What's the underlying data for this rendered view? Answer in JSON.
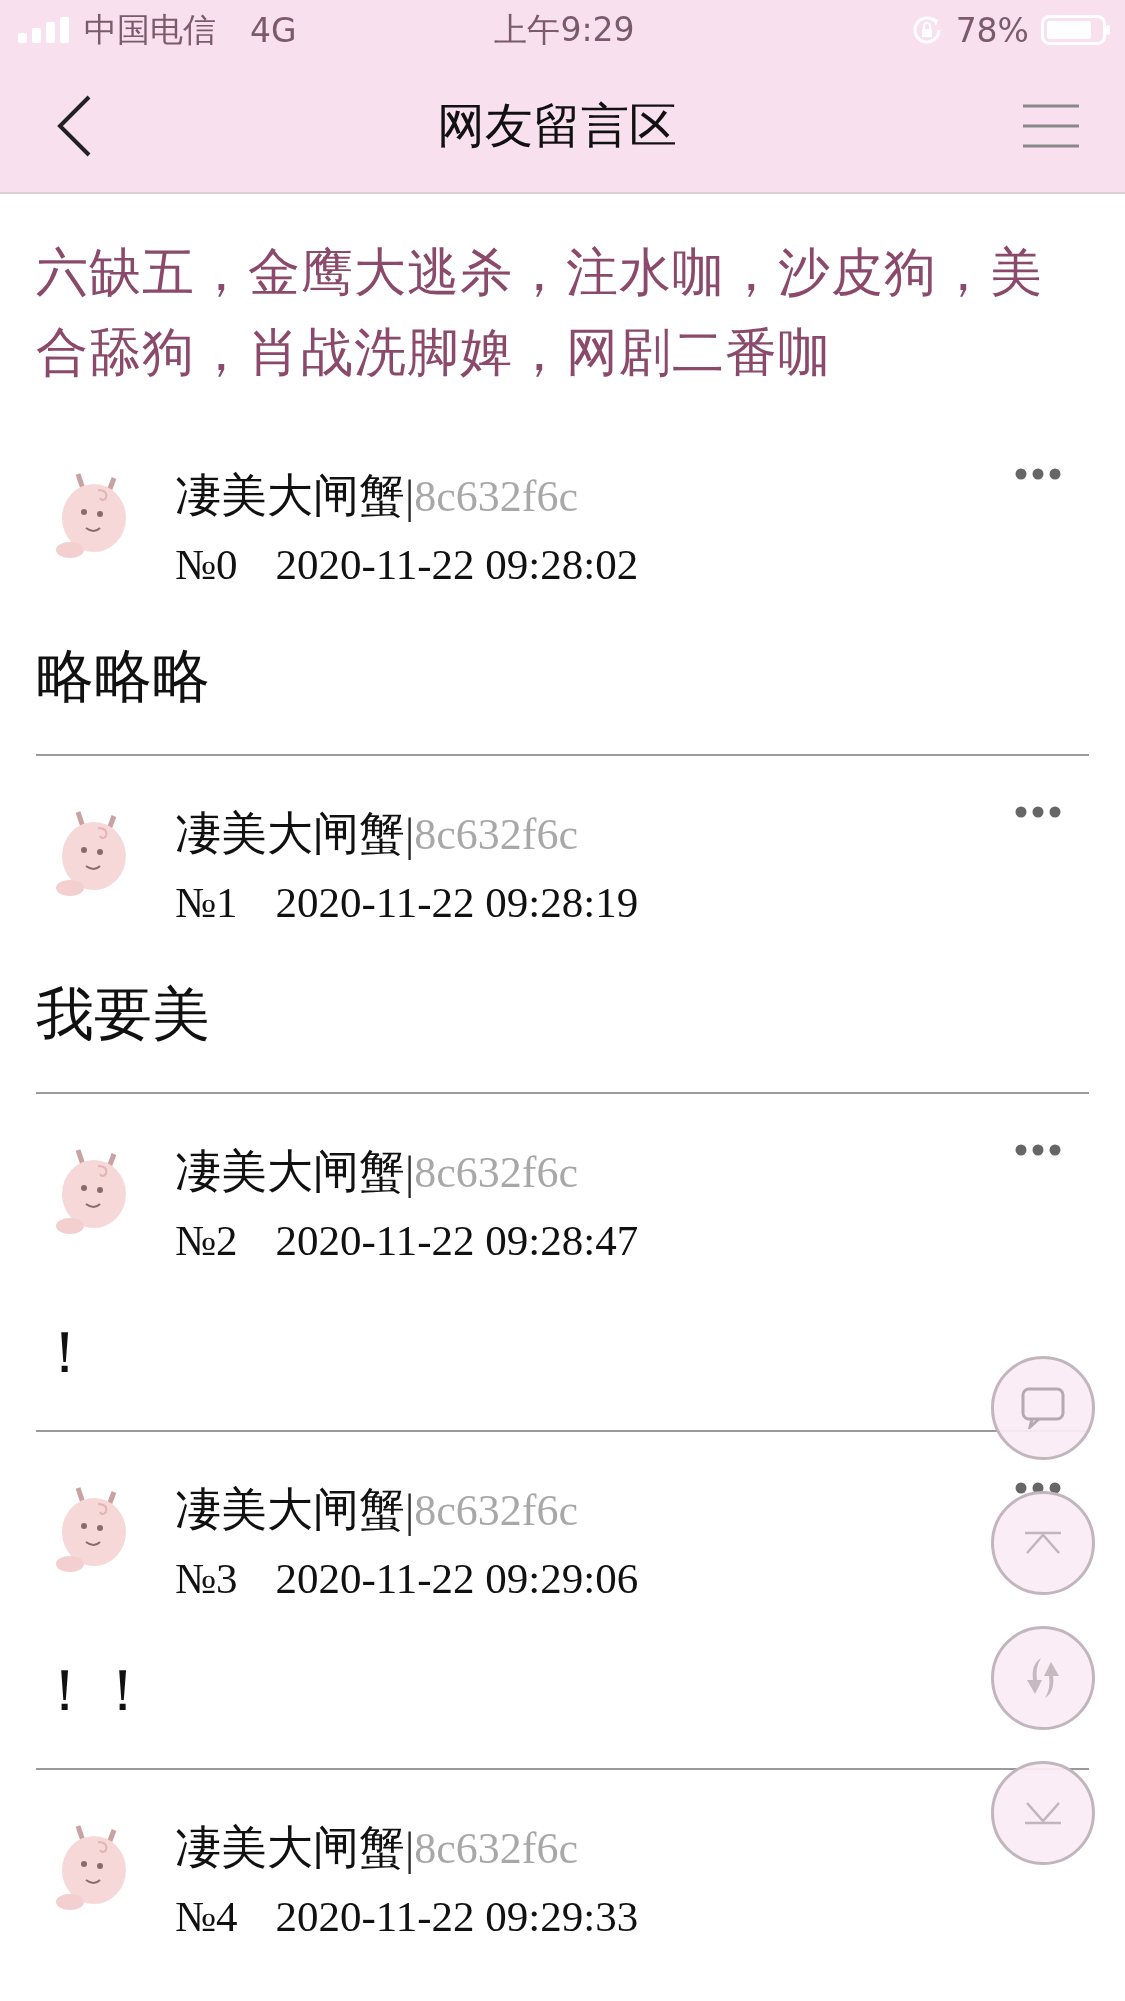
{
  "status_bar": {
    "carrier": "中国电信",
    "network": "4G",
    "time": "上午9:29",
    "battery": "78%"
  },
  "header": {
    "title": "网友留言区"
  },
  "notice": "六缺五，金鹰大逃杀，注水咖，沙皮狗，美合舔狗，肖战洗脚婢，网剧二番咖",
  "posts": [
    {
      "author": "凄美大闸蟹",
      "separator": "|",
      "user_id": "8c632f6c",
      "floor": "№0",
      "time": "2020-11-22 09:28:02",
      "content": "略略略",
      "more_menu": true
    },
    {
      "author": "凄美大闸蟹",
      "separator": "|",
      "user_id": "8c632f6c",
      "floor": "№1",
      "time": "2020-11-22 09:28:19",
      "content": "我要美",
      "more_menu": true
    },
    {
      "author": "凄美大闸蟹",
      "separator": "|",
      "user_id": "8c632f6c",
      "floor": "№2",
      "time": "2020-11-22 09:28:47",
      "content": "！",
      "more_menu": true
    },
    {
      "author": "凄美大闸蟹",
      "separator": "|",
      "user_id": "8c632f6c",
      "floor": "№3",
      "time": "2020-11-22 09:29:06",
      "content": "！！",
      "more_menu": true
    },
    {
      "author": "凄美大闸蟹",
      "separator": "|",
      "user_id": "8c632f6c",
      "floor": "№4",
      "time": "2020-11-22 09:29:33",
      "more_menu": false
    }
  ],
  "float_buttons": [
    {
      "kind": "comment"
    },
    {
      "kind": "top"
    },
    {
      "kind": "refresh"
    },
    {
      "kind": "bottom"
    }
  ]
}
